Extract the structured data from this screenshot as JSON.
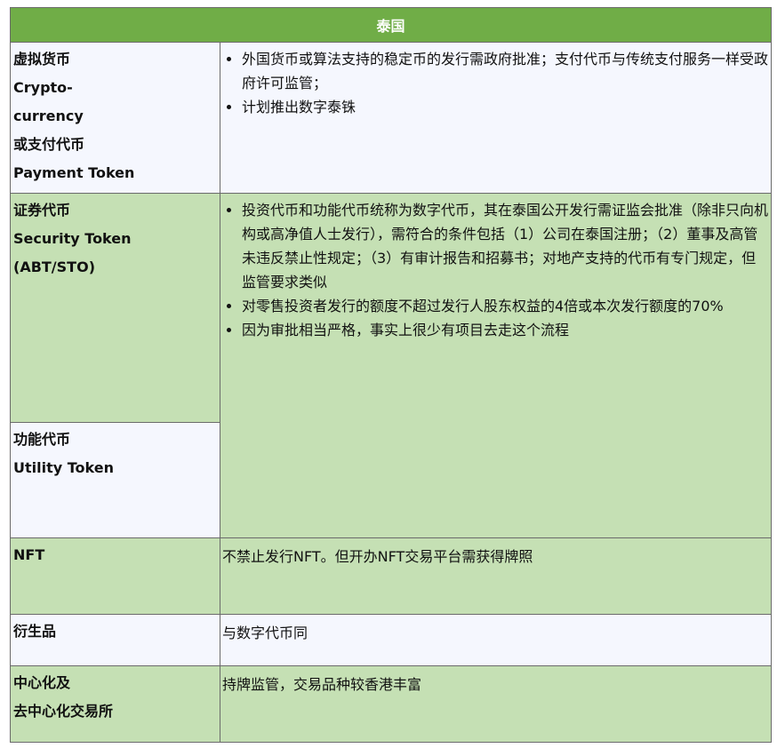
{
  "header": {
    "title": "泰国"
  },
  "rows": {
    "crypto": {
      "label_lines": [
        "虚拟货币",
        "Crypto-",
        "currency",
        "或支付代币",
        "Payment Token"
      ],
      "bullets": [
        "外国货币或算法支持的稳定币的发行需政府批准；支付代币与传统支付服务一样受政府许可监管；",
        "计划推出数字泰铢"
      ]
    },
    "security": {
      "label_lines": [
        "证券代币",
        "Security Token",
        "(ABT/STO)"
      ],
      "bullets": [
        "投资代币和功能代币统称为数字代币，其在泰国公开发行需证监会批准（除非只向机构或高净值人士发行），需符合的条件包括（1）公司在泰国注册；（2）董事及高管未违反禁止性规定；（3）有审计报告和招募书；对地产支持的代币有专门规定，但监管要求类似",
        "对零售投资者发行的额度不超过发行人股东权益的4倍或本次发行额度的70%",
        "因为审批相当严格，事实上很少有项目去走这个流程"
      ]
    },
    "utility": {
      "label_lines": [
        "功能代币",
        "Utility Token"
      ]
    },
    "nft": {
      "label": "NFT",
      "text": "不禁止发行NFT。但开办NFT交易平台需获得牌照"
    },
    "derivatives": {
      "label": "衍生品",
      "text": "与数字代币同"
    },
    "exchanges": {
      "label_lines": [
        "中心化及",
        "去中心化交易所"
      ],
      "text": "持牌监管，交易品种较香港丰富"
    }
  },
  "colors": {
    "header_bg": "#70ad47",
    "green_row": "#c5e0b4",
    "white_row": "#f5f7fe",
    "border": "#6b6b6b"
  }
}
